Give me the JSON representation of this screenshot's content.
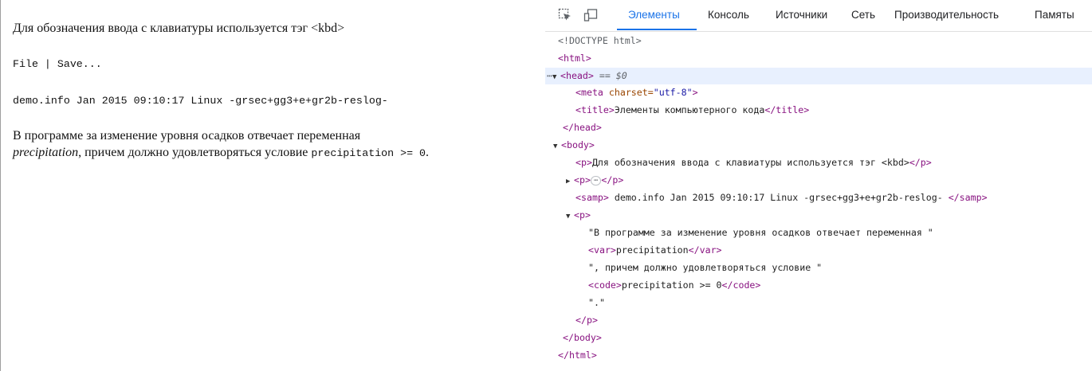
{
  "page": {
    "p1": "Для обозначения ввода с клавиатуры используется тэг <kbd>",
    "p2": "File | Save...",
    "samp": "demo.info Jan 2015 09:10:17 Linux -grsec+gg3+e+gr2b-reslog-",
    "p4_start": "В программе за изменение уровня осадков отвечает переменная",
    "p4_var": "precipitation",
    "p4_mid": ", причем должно удовлетворяться условие ",
    "p4_code": "precipitation >= 0",
    "p4_end": "."
  },
  "devtools": {
    "tabs": [
      "Элементы",
      "Консоль",
      "Источники",
      "Сеть",
      "Производительность",
      "Памяты"
    ],
    "active_tab": "Элементы",
    "icons": [
      "inspect-icon",
      "device-toggle-icon"
    ],
    "tree": {
      "doctype": "<!DOCTYPE html>",
      "html_open": "<html>",
      "head_open": "<head>",
      "head_marker": " == $0",
      "meta_tag": "<meta",
      "meta_attr": " charset=",
      "meta_val": "\"utf-8\"",
      "meta_close": ">",
      "title_open": "<title>",
      "title_text": "Элементы компьютерного кода",
      "title_close": "</title>",
      "head_close": "</head>",
      "body_open": "<body>",
      "p1_open": "<p>",
      "p1_text": "Для обозначения ввода с клавиатуры используется тэг <kbd>",
      "p1_close": "</p>",
      "p2_open": "<p>",
      "p2_close": "</p>",
      "samp_open": "<samp>",
      "samp_text": " demo.info Jan 2015 09:10:17 Linux -grsec+gg3+e+gr2b-reslog- ",
      "samp_close": "</samp>",
      "p4_open": "<p>",
      "text1": "\"В программе за изменение уровня осадков отвечает переменная \"",
      "var_open": "<var>",
      "var_text": "precipitation",
      "var_close": "</var>",
      "text2": "\", причем должно удовлетворяться условие \"",
      "code_open": "<code>",
      "code_text": "precipitation >= 0",
      "code_close": "</code>",
      "text3": "\".\"",
      "p4_close": "</p>",
      "body_close": "</body>",
      "html_close": "</html>"
    }
  },
  "colors": {
    "tag": "#881280",
    "attr": "#994500",
    "attr_value": "#1a1aa6",
    "active_tab": "#1a73e8",
    "selected_row": "#e8f0fe"
  }
}
